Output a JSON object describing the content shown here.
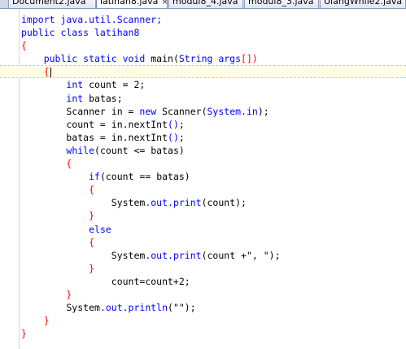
{
  "tabs": [
    {
      "label": "Document2.java",
      "active": false
    },
    {
      "label": "latihan8.java",
      "active": true,
      "close": "×"
    },
    {
      "label": "modul8_4.java",
      "active": false
    },
    {
      "label": "modul8_3.java",
      "active": false
    },
    {
      "label": "UlangWhile2.java",
      "active": false
    }
  ],
  "code_lines": [
    {
      "segs": [
        {
          "t": "import java.util.Scanner;",
          "c": "kw"
        }
      ]
    },
    {
      "segs": [
        {
          "t": "public class latihan8",
          "c": "kw"
        }
      ]
    },
    {
      "segs": [
        {
          "t": "{",
          "c": "br"
        }
      ]
    },
    {
      "segs": [
        {
          "t": "    public static void ",
          "c": "kw"
        },
        {
          "t": "main(",
          "c": ""
        },
        {
          "t": "String args",
          "c": "kw"
        },
        {
          "t": "[])",
          "c": "br"
        }
      ]
    },
    {
      "segs": [
        {
          "t": "    {",
          "c": "br"
        }
      ],
      "current": true
    },
    {
      "segs": [
        {
          "t": "        ",
          "c": ""
        },
        {
          "t": "int",
          "c": "kw"
        },
        {
          "t": " count = 2;",
          "c": ""
        }
      ]
    },
    {
      "segs": [
        {
          "t": "        ",
          "c": ""
        },
        {
          "t": "int",
          "c": "kw"
        },
        {
          "t": " batas;",
          "c": ""
        }
      ]
    },
    {
      "segs": [
        {
          "t": "        Scanner in = ",
          "c": ""
        },
        {
          "t": "new",
          "c": "kw"
        },
        {
          "t": " Scanner(",
          "c": ""
        },
        {
          "t": "System.in",
          "c": "kw"
        },
        {
          "t": ");",
          "c": ""
        }
      ]
    },
    {
      "segs": [
        {
          "t": "        count = in.nextInt",
          "c": ""
        },
        {
          "t": "()",
          "c": "kw"
        },
        {
          "t": ";",
          "c": ""
        }
      ]
    },
    {
      "segs": [
        {
          "t": "        batas = in.nextInt",
          "c": ""
        },
        {
          "t": "()",
          "c": "kw"
        },
        {
          "t": ";",
          "c": ""
        }
      ]
    },
    {
      "segs": [
        {
          "t": "        ",
          "c": ""
        },
        {
          "t": "while",
          "c": "kw"
        },
        {
          "t": "(count <= batas)",
          "c": ""
        }
      ]
    },
    {
      "segs": [
        {
          "t": "        {",
          "c": "br"
        }
      ]
    },
    {
      "segs": [
        {
          "t": "            ",
          "c": ""
        },
        {
          "t": "if",
          "c": "kw"
        },
        {
          "t": "(count == batas)",
          "c": ""
        }
      ]
    },
    {
      "segs": [
        {
          "t": "            {",
          "c": "br"
        }
      ]
    },
    {
      "segs": [
        {
          "t": "                System",
          "c": ""
        },
        {
          "t": ".out.print",
          "c": "kw"
        },
        {
          "t": "(count);",
          "c": ""
        }
      ]
    },
    {
      "segs": [
        {
          "t": "            }",
          "c": "br"
        }
      ]
    },
    {
      "segs": [
        {
          "t": "            ",
          "c": ""
        },
        {
          "t": "else",
          "c": "kw"
        }
      ]
    },
    {
      "segs": [
        {
          "t": "            {",
          "c": "br"
        }
      ]
    },
    {
      "segs": [
        {
          "t": "                System",
          "c": ""
        },
        {
          "t": ".out.print",
          "c": "kw"
        },
        {
          "t": "(count +\", \");",
          "c": ""
        }
      ]
    },
    {
      "segs": [
        {
          "t": "            }",
          "c": "br"
        }
      ]
    },
    {
      "segs": [
        {
          "t": "                count=count+2;",
          "c": ""
        }
      ]
    },
    {
      "segs": [
        {
          "t": "        }",
          "c": "br"
        }
      ]
    },
    {
      "segs": [
        {
          "t": "        System",
          "c": ""
        },
        {
          "t": ".out.println",
          "c": "kw"
        },
        {
          "t": "(\"\");",
          "c": ""
        }
      ]
    },
    {
      "segs": [
        {
          "t": "    }",
          "c": "br"
        }
      ]
    },
    {
      "segs": [
        {
          "t": "}",
          "c": "br"
        }
      ]
    }
  ],
  "colors": {
    "keyword": "#0000ff",
    "bracket": "#ff0000",
    "text": "#000000",
    "current_line": "#ffffe6"
  }
}
